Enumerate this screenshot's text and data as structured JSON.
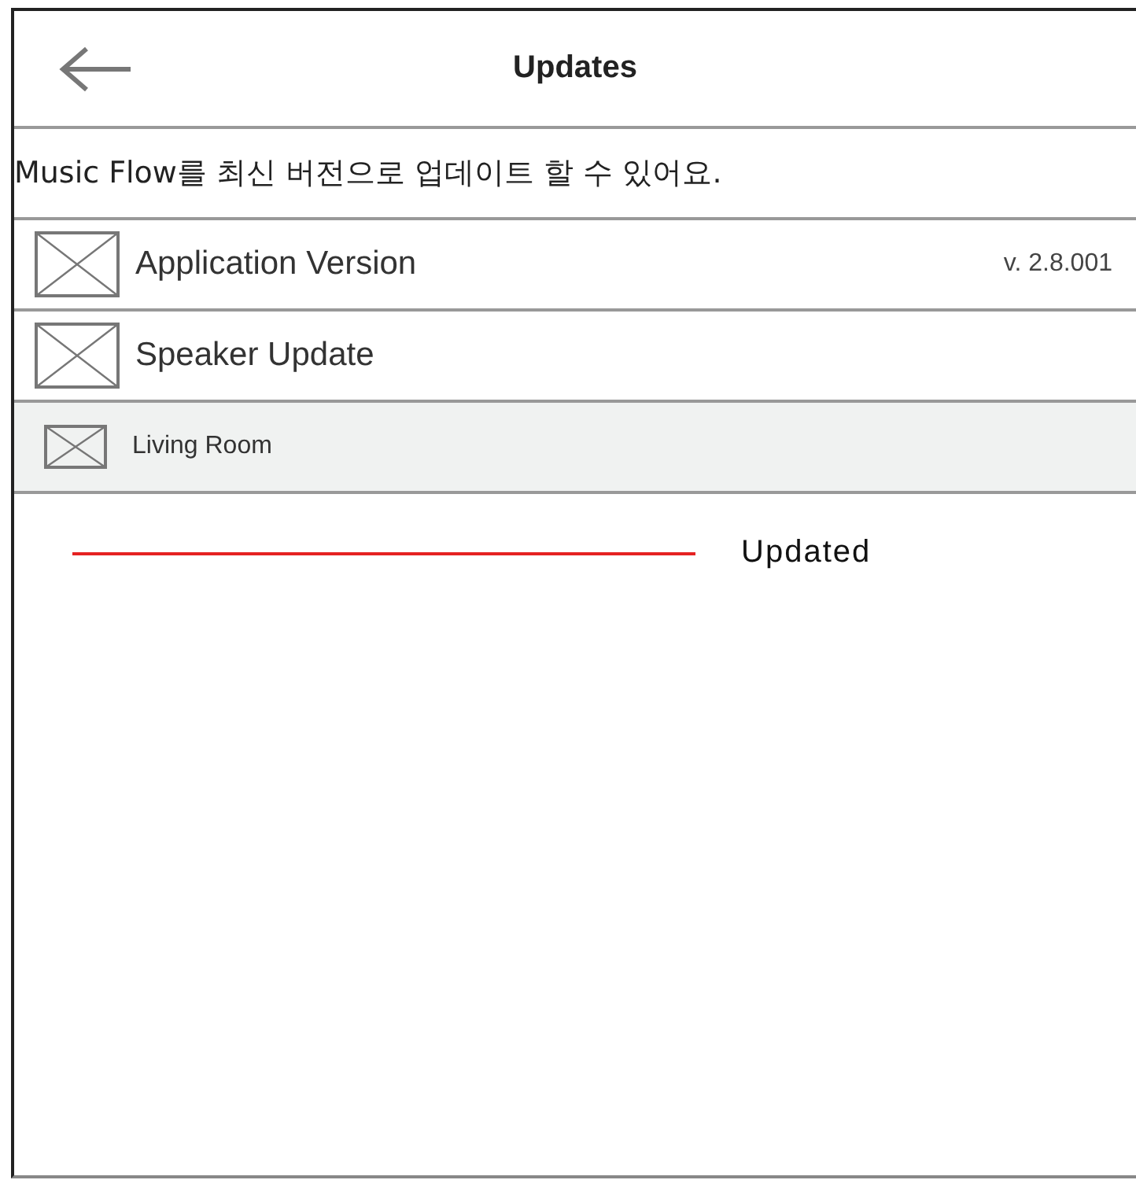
{
  "header": {
    "title": "Updates"
  },
  "description": "Music Flow를 최신 버전으로 업데이트 할 수 있어요.",
  "items": [
    {
      "kind": "setting",
      "label": "Application Version",
      "value": "v. 2.8.001"
    },
    {
      "kind": "setting",
      "label": "Speaker Update"
    },
    {
      "kind": "device",
      "label": "Living Room"
    }
  ],
  "legend": {
    "label": "Updated"
  }
}
